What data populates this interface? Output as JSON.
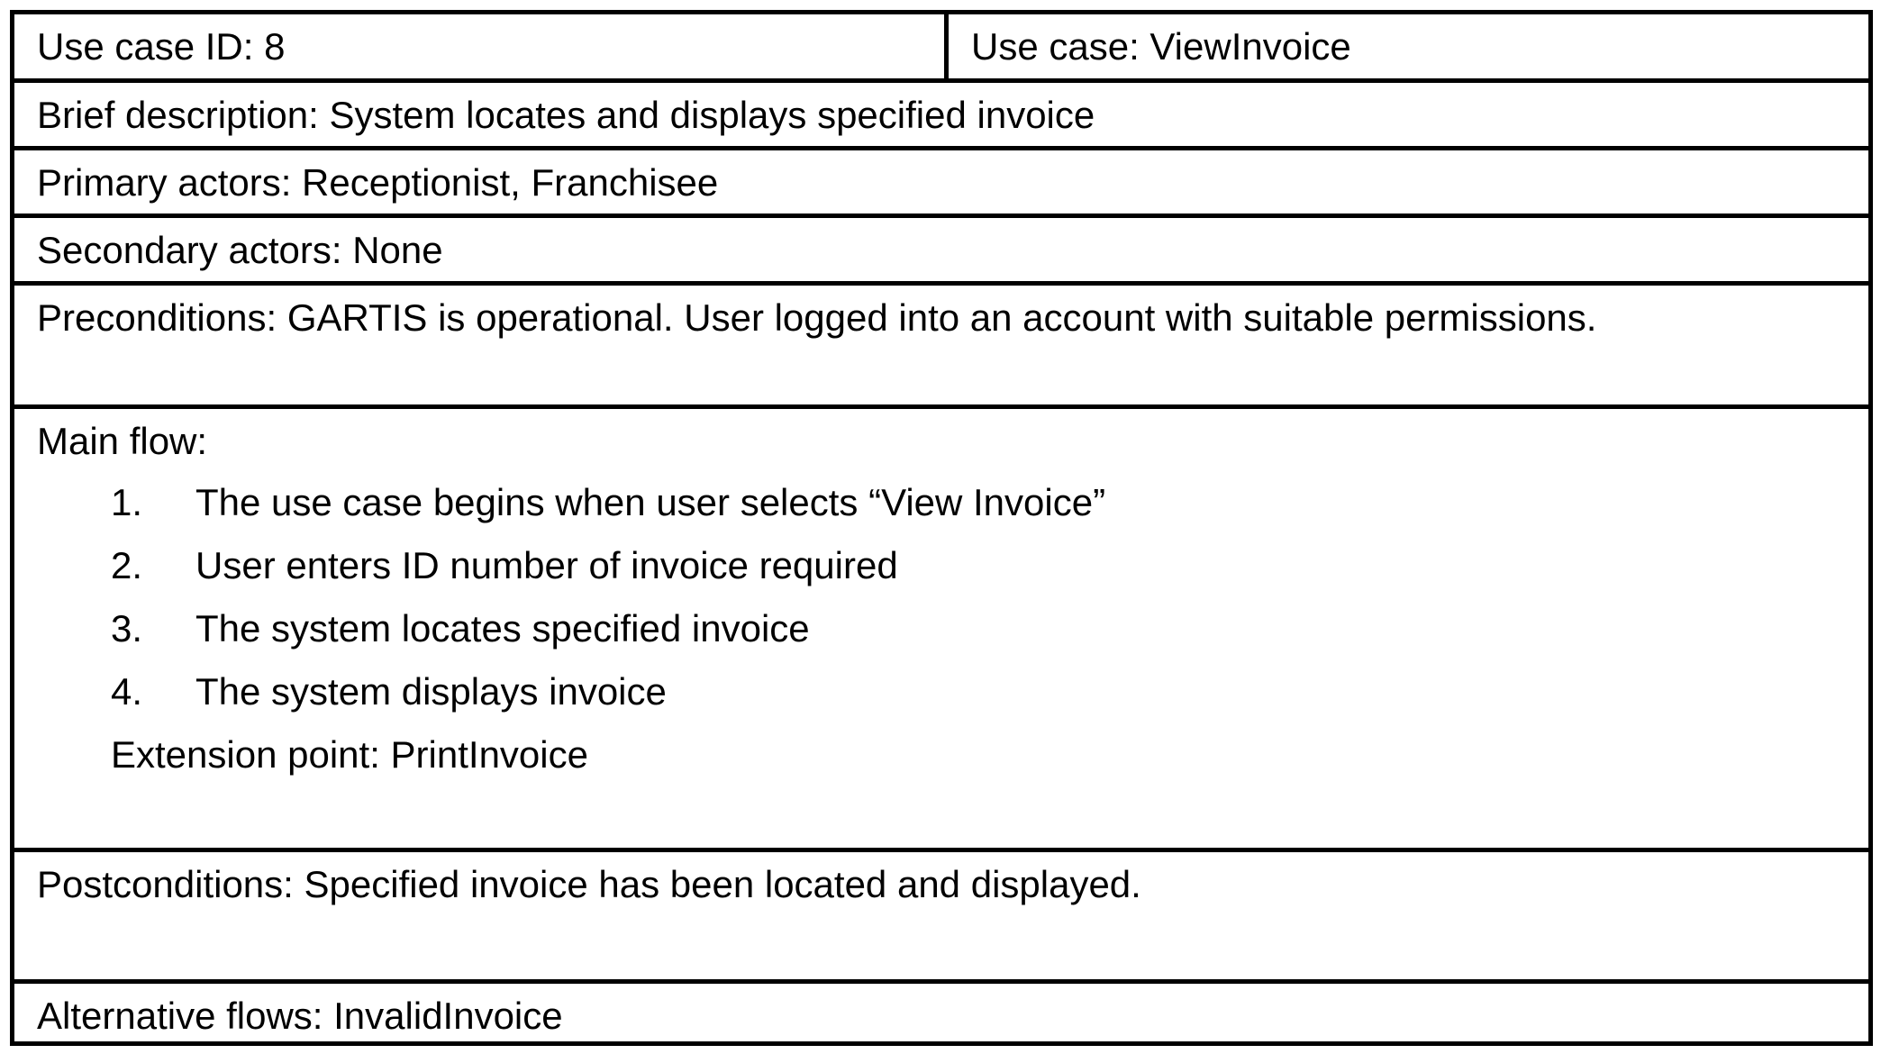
{
  "use_case": {
    "id_label": "Use case ID:",
    "id_value": "8",
    "name_label": "Use case:",
    "name_value": "ViewInvoice",
    "brief_label": "Brief description:",
    "brief_value": "System locates and displays specified invoice",
    "primary_label": "Primary actors:",
    "primary_value": "Receptionist, Franchisee",
    "secondary_label": "Secondary actors:",
    "secondary_value": "None",
    "preconditions_label": "Preconditions:",
    "preconditions_value": "GARTIS is operational. User logged into an account with suitable permissions.",
    "main_flow_label": "Main flow:",
    "main_flow_steps": [
      {
        "num": "1.",
        "text": "The use case begins when user selects “View Invoice”"
      },
      {
        "num": "2.",
        "text": "User enters ID number of invoice required"
      },
      {
        "num": "3.",
        "text": "The system locates specified invoice"
      },
      {
        "num": "4.",
        "text": "The system displays invoice"
      }
    ],
    "extension_label": "Extension point:",
    "extension_value": "PrintInvoice",
    "postconditions_label": "Postconditions:",
    "postconditions_value": "Specified invoice has been located and displayed.",
    "alternative_label": "Alternative flows:",
    "alternative_value": "InvalidInvoice"
  }
}
